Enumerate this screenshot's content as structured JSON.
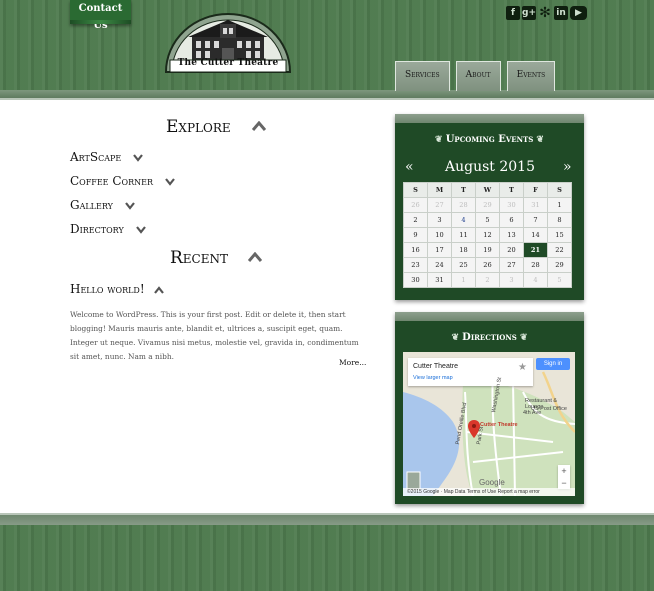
{
  "header": {
    "contact_label": "Contact Us",
    "logo_text": "The Cutter Theatre",
    "social_icons": [
      "facebook-icon",
      "google-plus-icon",
      "yelp-icon",
      "linkedin-icon",
      "youtube-icon"
    ],
    "nav": [
      "Services",
      "About",
      "Events"
    ]
  },
  "explore": {
    "title": "Explore",
    "items": [
      "ArtScape",
      "Coffee Corner",
      "Gallery",
      "Directory"
    ]
  },
  "recent": {
    "title": "Recent",
    "post_title": "Hello world!",
    "excerpt": "Welcome to WordPress. This is your first post. Edit or delete it, then start blogging! Mauris mauris ante, blandit et, ultrices a, suscipit eget, quam. Integer ut neque. Vivamus nisi metus, molestie vel, gravida in, condimentum sit amet, nunc. Nam a nibh.",
    "more": "More..."
  },
  "events_widget": {
    "title": "Upcoming Events",
    "month": "August 2015",
    "prev": "«",
    "next": "»",
    "weekdays": [
      "S",
      "M",
      "T",
      "W",
      "T",
      "F",
      "S"
    ],
    "weeks": [
      [
        "26",
        "27",
        "28",
        "29",
        "30",
        "31",
        "1"
      ],
      [
        "2",
        "3",
        "4",
        "5",
        "6",
        "7",
        "8"
      ],
      [
        "9",
        "10",
        "11",
        "12",
        "13",
        "14",
        "15"
      ],
      [
        "16",
        "17",
        "18",
        "19",
        "20",
        "21",
        "22"
      ],
      [
        "23",
        "24",
        "25",
        "26",
        "27",
        "28",
        "29"
      ],
      [
        "30",
        "31",
        "1",
        "2",
        "3",
        "4",
        "5"
      ]
    ],
    "today": "21",
    "linked_day": "4"
  },
  "directions_widget": {
    "title": "Directions",
    "place_name": "Cutter Theatre",
    "view_larger": "View larger map",
    "sign_in": "Sign in",
    "pin_label": "Cutter Theatre",
    "labels": [
      "Restaurant & Lounge",
      "4th Ave",
      "US Post Office",
      "Pend Oreille Blvd",
      "Park St",
      "Washington St"
    ],
    "google": "Google",
    "footer": "©2015 Google · Map Data   Terms of Use   Report a map error",
    "zoom_in": "+",
    "zoom_out": "−"
  },
  "colors": {
    "header_green": "#4e7a4e",
    "widget_green": "#1f4a26",
    "contact_green": "#2a6a32",
    "today_bg": "#1f4a26"
  }
}
